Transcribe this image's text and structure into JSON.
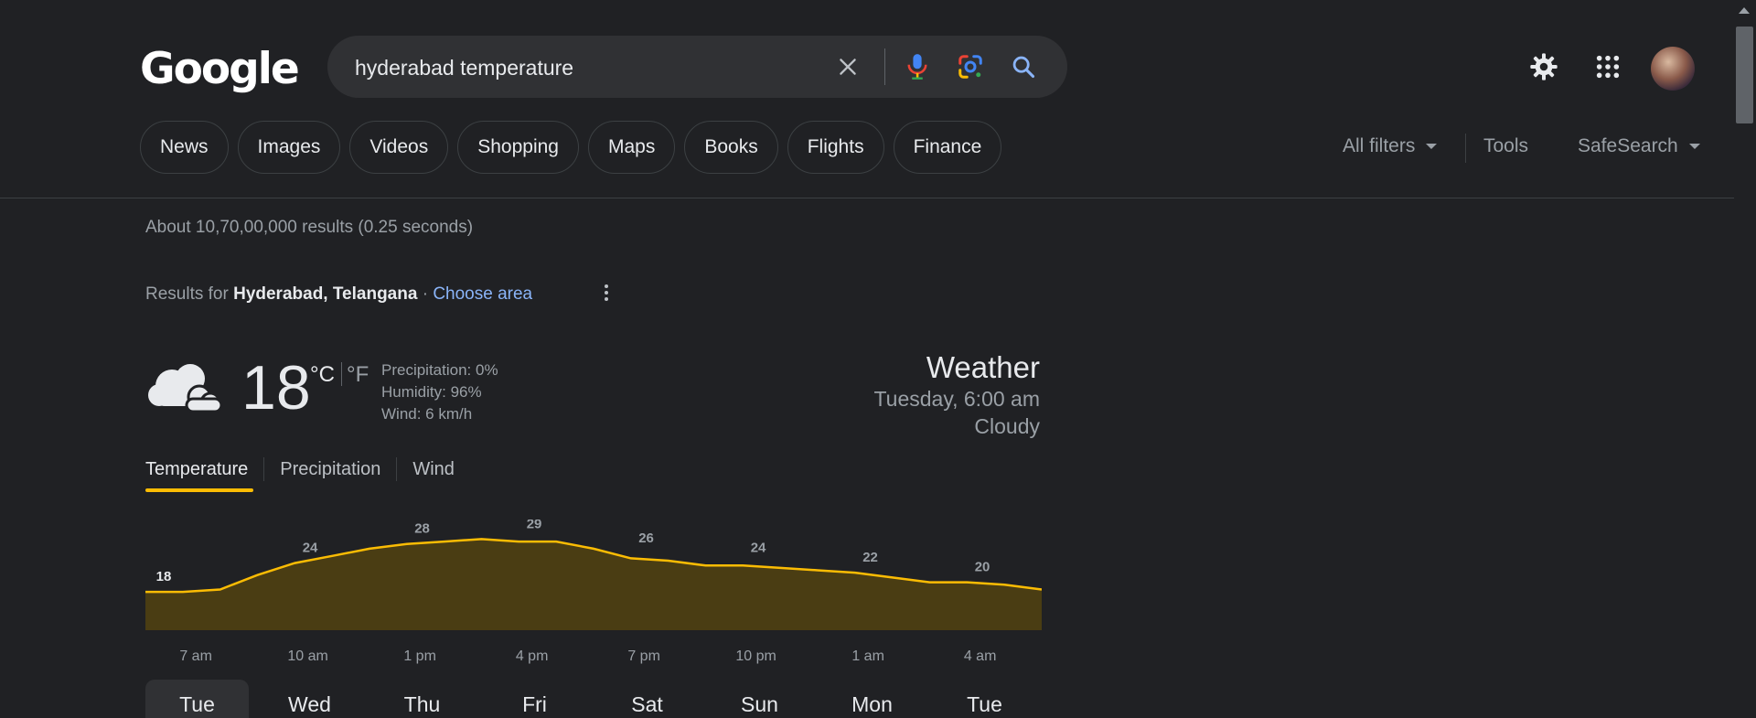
{
  "header": {
    "logo": "Google",
    "search_value": "hyderabad temperature",
    "icons": [
      "close-icon",
      "microphone-icon",
      "google-lens-icon",
      "search-icon",
      "gear-icon",
      "apps-grid-icon",
      "avatar"
    ]
  },
  "tabs": [
    "News",
    "Images",
    "Videos",
    "Shopping",
    "Maps",
    "Books",
    "Flights",
    "Finance"
  ],
  "filters": {
    "all_filters": "All filters",
    "tools": "Tools",
    "safesearch": "SafeSearch"
  },
  "result_stats": "About 10,70,00,000 results (0.25 seconds)",
  "results_for": {
    "prefix": "Results for ",
    "location": "Hyderabad, Telangana",
    "separator": " · ",
    "choose_area": "Choose area"
  },
  "weather": {
    "temperature": "18",
    "unit_c": "°C",
    "unit_f": "°F",
    "precipitation": "Precipitation: 0%",
    "humidity": "Humidity: 96%",
    "wind": "Wind: 6 km/h",
    "title": "Weather",
    "time": "Tuesday, 6:00 am",
    "condition": "Cloudy",
    "tabs": [
      "Temperature",
      "Precipitation",
      "Wind"
    ],
    "days": [
      "Tue",
      "Wed",
      "Thu",
      "Fri",
      "Sat",
      "Sun",
      "Mon",
      "Tue"
    ],
    "selected_day": "Tue"
  },
  "colors": {
    "accent_line": "#fbbc04",
    "area_fill": "#4a3d13",
    "link": "#8ab4f8"
  },
  "chart_data": {
    "type": "area",
    "x_ticks": [
      "7 am",
      "10 am",
      "1 pm",
      "4 pm",
      "7 pm",
      "10 pm",
      "1 am",
      "4 am"
    ],
    "labels": [
      {
        "time_index": 0,
        "value": 18
      },
      {
        "time_index": 1,
        "value": 24
      },
      {
        "time_index": 2,
        "value": 28
      },
      {
        "time_index": 3,
        "value": 29
      },
      {
        "time_index": 4,
        "value": 26
      },
      {
        "time_index": 5,
        "value": 24
      },
      {
        "time_index": 6,
        "value": 22
      },
      {
        "time_index": 7,
        "value": 20
      }
    ],
    "series_values": [
      18,
      18,
      18.5,
      21.5,
      24,
      25.5,
      27,
      28,
      28.5,
      29,
      28.5,
      28.5,
      27,
      25,
      24.5,
      23.5,
      23.5,
      23,
      22.5,
      22,
      21,
      20,
      20,
      19.5,
      18.5
    ],
    "ylim": [
      10,
      35
    ]
  }
}
